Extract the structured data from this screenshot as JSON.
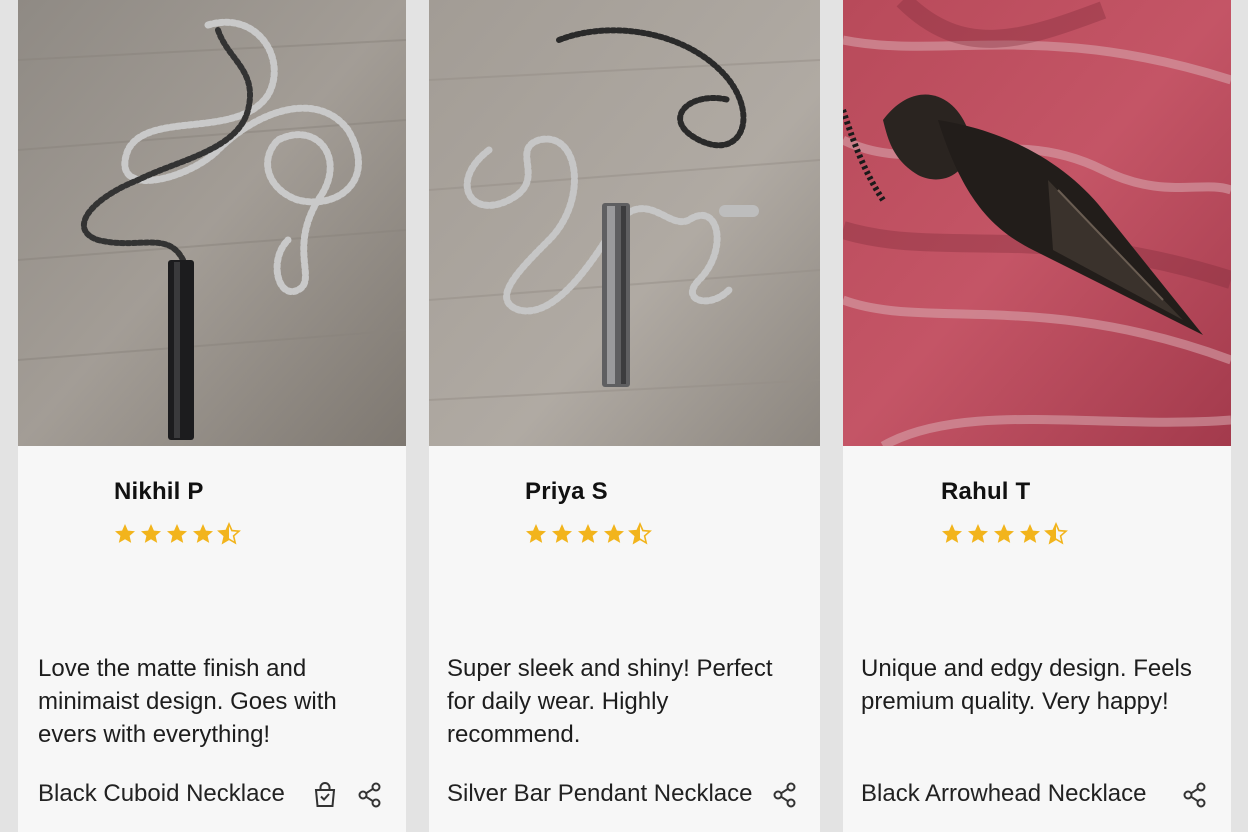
{
  "reviews": [
    {
      "reviewer": "Nikhil P",
      "rating": 4.5,
      "text": "Love the matte finish and minimaist design. Goes with evers with everything!",
      "product": "Black Cuboid Necklace",
      "icons": [
        "shopping-bag-icon",
        "share-icon"
      ]
    },
    {
      "reviewer": "Priya S",
      "rating": 4.5,
      "text": "Super sleek and shiny! Perfect for daily wear. Highly recommend.",
      "product": "Silver Bar Pendant Necklace",
      "icons": [
        "share-icon"
      ]
    },
    {
      "reviewer": "Rahul T",
      "rating": 4.5,
      "text": "Unique and edgy design. Feels premium quality. Very happy!",
      "product": "Black Arrowhead Necklace",
      "icons": [
        "share-icon"
      ]
    }
  ],
  "colors": {
    "star": "#f2b41c",
    "card": "#f7f7f7",
    "background": "#e3e3e3"
  }
}
